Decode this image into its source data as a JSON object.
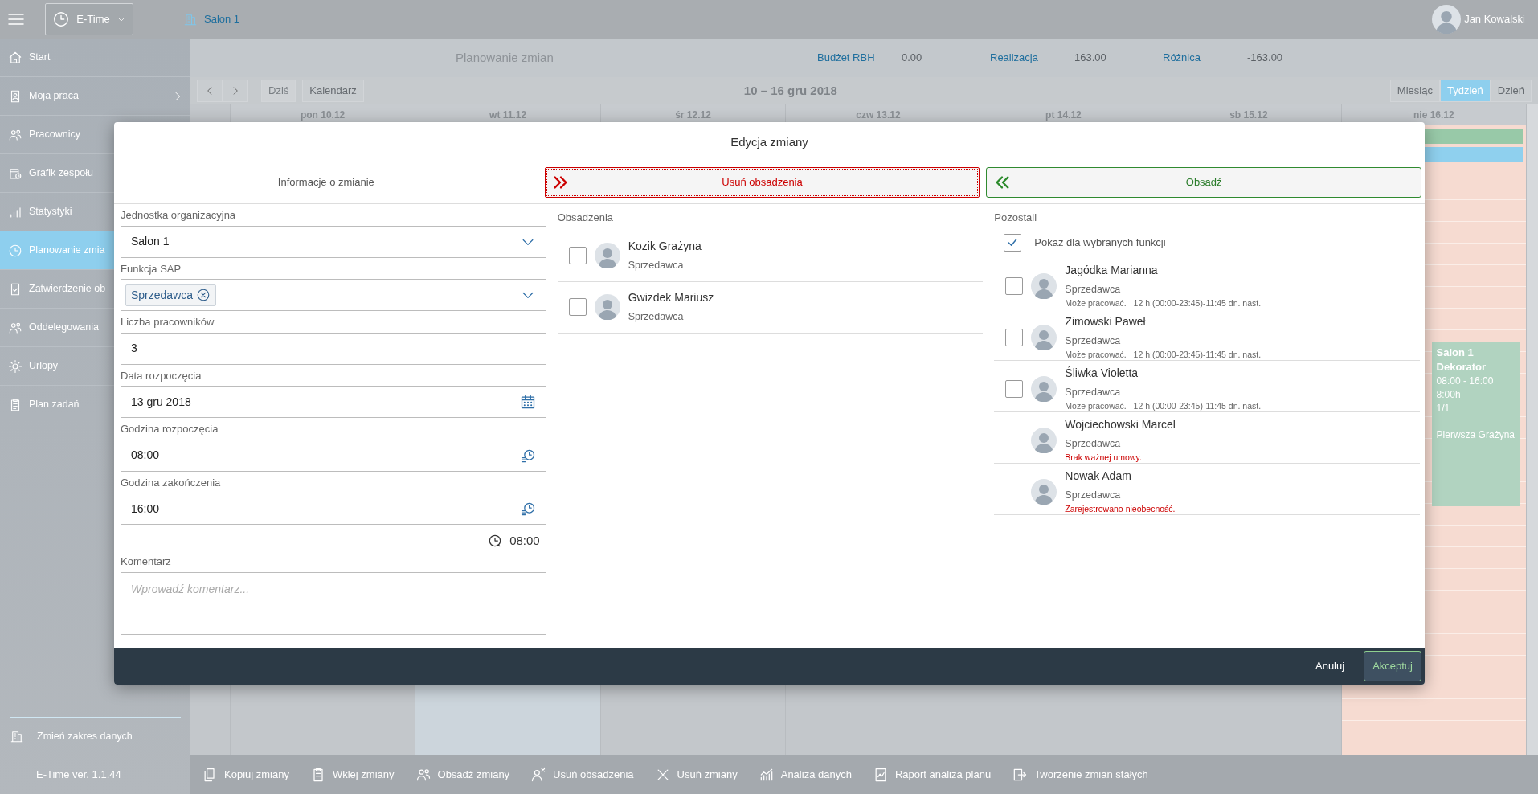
{
  "app_bar": {
    "app_switch": "E-Time",
    "location": "Salon 1",
    "user": "Jan Kowalski"
  },
  "sidebar": {
    "items": [
      {
        "label": "Start",
        "selected": false
      },
      {
        "label": "Moja praca",
        "selected": false,
        "has_submenu": true
      },
      {
        "label": "Pracownicy",
        "selected": false
      },
      {
        "label": "Grafik zespołu",
        "selected": false
      },
      {
        "label": "Statystyki",
        "selected": false
      },
      {
        "label": "Planowanie zmia",
        "selected": true
      },
      {
        "label": "Zatwierdzenie ob",
        "selected": false
      },
      {
        "label": "Oddelegowania",
        "selected": false
      },
      {
        "label": "Urlopy",
        "selected": false
      },
      {
        "label": "Plan zadań",
        "selected": false
      }
    ],
    "footer_item": "Zmień zakres danych",
    "version": "E-Time ver. 1.1.44"
  },
  "header": {
    "title": "Planowanie zmian",
    "metrics": [
      {
        "label": "Budżet RBH",
        "value": "0.00"
      },
      {
        "label": "Realizacja",
        "value": "163.00"
      },
      {
        "label": "Różnica",
        "value": "-163.00"
      }
    ]
  },
  "calendar_toolbar": {
    "today": {
      "label": "Dziś",
      "disabled": true
    },
    "calendar_button": "Kalendarz",
    "range": "10 – 16 gru 2018",
    "views": [
      {
        "label": "Miesiąc",
        "selected": false
      },
      {
        "label": "Tydzień",
        "selected": true
      },
      {
        "label": "Dzień",
        "selected": false
      }
    ]
  },
  "calendar": {
    "days": [
      {
        "label": "pon 10.12",
        "color": "#c3c7cb"
      },
      {
        "label": "wt 11.12",
        "color": "#ccd5dc"
      },
      {
        "label": "śr 12.12",
        "color": "#c3c7cb"
      },
      {
        "label": "czw 13.12",
        "color": "#c3c7cb"
      },
      {
        "label": "pt 14.12",
        "color": "#c3c7cb"
      },
      {
        "label": "sb 15.12",
        "color": "#c3c7cb"
      },
      {
        "label": "nie 16.12",
        "color": "#f6dbd1"
      }
    ],
    "all_day_bars": [
      {
        "color": "#98c9a8"
      },
      {
        "color": "#8fd0ee"
      }
    ],
    "event": {
      "title": "Salon 1",
      "subtitle": "Dekorator",
      "lines": [
        "08:00 - 16:00",
        "8:00h",
        "1/1"
      ],
      "employee": "Pierwsza Grażyna"
    }
  },
  "toolbar": [
    "Kopiuj zmiany",
    "Wklej zmiany",
    "Obsadź zmiany",
    "Usuń obsadzenia",
    "Usuń zmiany",
    "Analiza danych",
    "Raport analiza planu",
    "Tworzenie zmian stałych"
  ],
  "dialog": {
    "title": "Edycja zmiany",
    "tabs": {
      "info": "Informacje o zmianie",
      "remove": "Usuń obsadzenia",
      "assign": "Obsadź"
    },
    "fields": [
      {
        "kind": "select",
        "label": "Jednostka organizacyjna",
        "value": "Salon 1"
      },
      {
        "kind": "tokens",
        "label": "Funkcja SAP",
        "tokens": [
          "Sprzedawca"
        ]
      },
      {
        "kind": "text",
        "label": "Liczba pracowników",
        "value": "3"
      },
      {
        "kind": "date",
        "label": "Data rozpoczęcia",
        "value": "13 gru 2018"
      },
      {
        "kind": "time",
        "label": "Godzina rozpoczęcia",
        "value": "08:00"
      },
      {
        "kind": "time",
        "label": "Godzina zakończenia",
        "value": "16:00"
      },
      {
        "kind": "duration",
        "value": "08:00"
      },
      {
        "kind": "textarea",
        "label": "Komentarz",
        "placeholder": "Wprowadź komentarz..."
      }
    ],
    "assigned": {
      "title": "Obsadzenia",
      "people": [
        {
          "name": "Kozik Grażyna",
          "role": "Sprzedawca",
          "checked": false
        },
        {
          "name": "Gwizdek Mariusz",
          "role": "Sprzedawca",
          "checked": false
        }
      ]
    },
    "others": {
      "title": "Pozostali",
      "filter": {
        "label": "Pokaż dla wybranych funkcji",
        "checked": true
      },
      "people": [
        {
          "name": "Jagódka Marianna",
          "role": "Sprzedawca",
          "selectable": true,
          "checked": false,
          "note": {
            "kind": "info",
            "text": "Może pracować.   12 h;(00:00-23:45)-11:45 dn. nast."
          }
        },
        {
          "name": "Zimowski Paweł",
          "role": "Sprzedawca",
          "selectable": true,
          "checked": false,
          "note": {
            "kind": "info",
            "text": "Może pracować.   12 h;(00:00-23:45)-11:45 dn. nast."
          }
        },
        {
          "name": "Śliwka Violetta",
          "role": "Sprzedawca",
          "selectable": true,
          "checked": false,
          "note": {
            "kind": "info",
            "text": "Może pracować.   12 h;(00:00-23:45)-11:45 dn. nast."
          }
        },
        {
          "name": "Wojciechowski Marcel",
          "role": "Sprzedawca",
          "selectable": false,
          "checked": false,
          "note": {
            "kind": "error",
            "text": "Brak ważnej umowy."
          }
        },
        {
          "name": "Nowak Adam",
          "role": "Sprzedawca",
          "selectable": false,
          "checked": false,
          "note": {
            "kind": "error",
            "text": "Zarejestrowano nieobecność."
          }
        }
      ]
    },
    "footer": {
      "cancel": "Anuluj",
      "accept": "Akceptuj"
    }
  }
}
